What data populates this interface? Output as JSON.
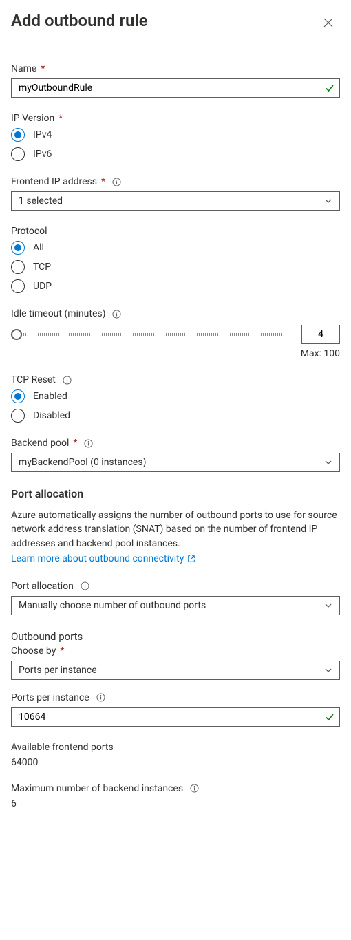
{
  "header": {
    "title": "Add outbound rule"
  },
  "fields": {
    "name": {
      "label": "Name",
      "value": "myOutboundRule"
    },
    "ipVersion": {
      "label": "IP Version",
      "options": {
        "ipv4": "IPv4",
        "ipv6": "IPv6"
      },
      "selected": "ipv4"
    },
    "frontendIp": {
      "label": "Frontend IP address",
      "value": "1 selected"
    },
    "protocol": {
      "label": "Protocol",
      "options": {
        "all": "All",
        "tcp": "TCP",
        "udp": "UDP"
      },
      "selected": "all"
    },
    "idleTimeout": {
      "label": "Idle timeout (minutes)",
      "value": "4",
      "maxLabel": "Max: 100"
    },
    "tcpReset": {
      "label": "TCP Reset",
      "options": {
        "enabled": "Enabled",
        "disabled": "Disabled"
      },
      "selected": "enabled"
    },
    "backendPool": {
      "label": "Backend pool",
      "value": "myBackendPool (0 instances)"
    }
  },
  "portAllocation": {
    "heading": "Port allocation",
    "description": "Azure automatically assigns the number of outbound ports to use for source network address translation (SNAT) based on the number of frontend IP addresses and backend pool instances.",
    "learnMore": "Learn more about outbound connectivity",
    "allocationLabel": "Port allocation",
    "allocationValue": "Manually choose number of outbound ports",
    "outboundPortsHeading": "Outbound ports",
    "chooseByLabel": "Choose by",
    "chooseByValue": "Ports per instance",
    "portsPerInstanceLabel": "Ports per instance",
    "portsPerInstanceValue": "10664",
    "availablePortsLabel": "Available frontend ports",
    "availablePortsValue": "64000",
    "maxBackendLabel": "Maximum number of backend instances",
    "maxBackendValue": "6"
  }
}
